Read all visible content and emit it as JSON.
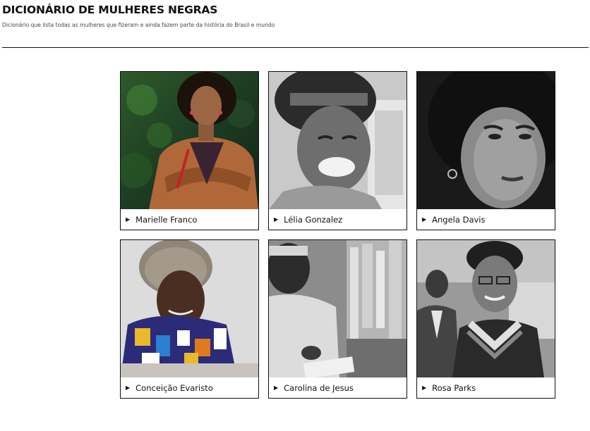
{
  "page": {
    "title": "DICIONÁRIO DE MULHERES NEGRAS",
    "subtitle": "Dicionário que lista todas as mulheres que fizeram e ainda fazem parte da história do Brasil e mundo"
  },
  "cards": [
    {
      "name": "Marielle Franco",
      "photo_style": "color"
    },
    {
      "name": "Lélia Gonzalez",
      "photo_style": "grayscale"
    },
    {
      "name": "Angela Davis",
      "photo_style": "grayscale"
    },
    {
      "name": "Conceição Evaristo",
      "photo_style": "color"
    },
    {
      "name": "Carolina de Jesus",
      "photo_style": "grayscale"
    },
    {
      "name": "Rosa Parks",
      "photo_style": "grayscale"
    }
  ],
  "icons": {
    "caption_marker": "triangle-right-icon"
  }
}
